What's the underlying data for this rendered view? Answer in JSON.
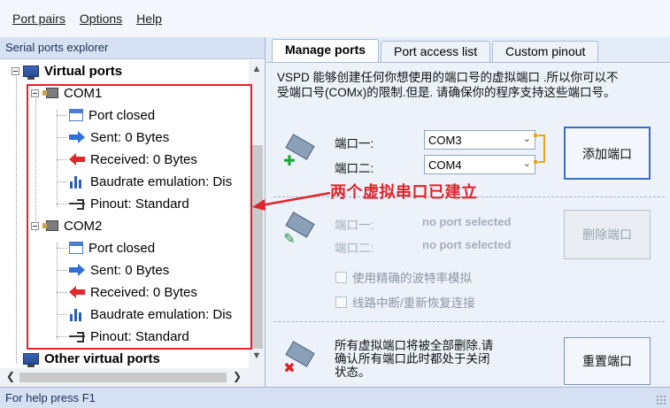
{
  "menu": {
    "items": [
      {
        "label": "Port pairs"
      },
      {
        "label": "Options"
      },
      {
        "label": "Help"
      }
    ]
  },
  "explorer": {
    "header": "Serial ports explorer",
    "root_label": "Virtual ports",
    "com1": {
      "label": "COM1",
      "children": [
        "Port closed",
        "Sent: 0 Bytes",
        "Received: 0 Bytes",
        "Baudrate emulation: Dis",
        "Pinout: Standard"
      ]
    },
    "com2": {
      "label": "COM2",
      "children": [
        "Port closed",
        "Sent: 0 Bytes",
        "Received: 0 Bytes",
        "Baudrate emulation: Dis",
        "Pinout: Standard"
      ]
    },
    "other_label": "Other virtual ports"
  },
  "tabs": [
    {
      "label": "Manage ports",
      "active": true
    },
    {
      "label": "Port access list",
      "active": false
    },
    {
      "label": "Custom pinout",
      "active": false
    }
  ],
  "manage": {
    "description_line1": "VSPD 能够创建任何你想使用的端口号的虚拟端口 .所以你可以不",
    "description_line2": "受端口号(COMx)的限制.但是. 请确保你的程序支持这些端口号。",
    "add": {
      "port1_label": "端口一:",
      "port2_label": "端口二:",
      "port1_value": "COM3",
      "port2_value": "COM4",
      "button": "添加端口"
    },
    "delete": {
      "port1_label": "端口一:",
      "port2_label": "端口二:",
      "port1_value": "no port selected",
      "port2_value": "no port selected",
      "button": "删除端口",
      "check1": "使用精确的波特率模拟",
      "check2": "线路中断/重新恢复连接"
    },
    "reset": {
      "text_line1": "所有虚拟端口将被全部删除.请",
      "text_line2": "确认所有端口此时都处于关闭",
      "text_line3": "状态。",
      "button": "重置端口"
    }
  },
  "annotation": "两个虚拟串口已建立",
  "status": "For help press F1",
  "colors": {
    "annotation_red": "#e0242b",
    "bracket_orange": "#e1a61a",
    "accent_blue": "#3b6fc4"
  }
}
